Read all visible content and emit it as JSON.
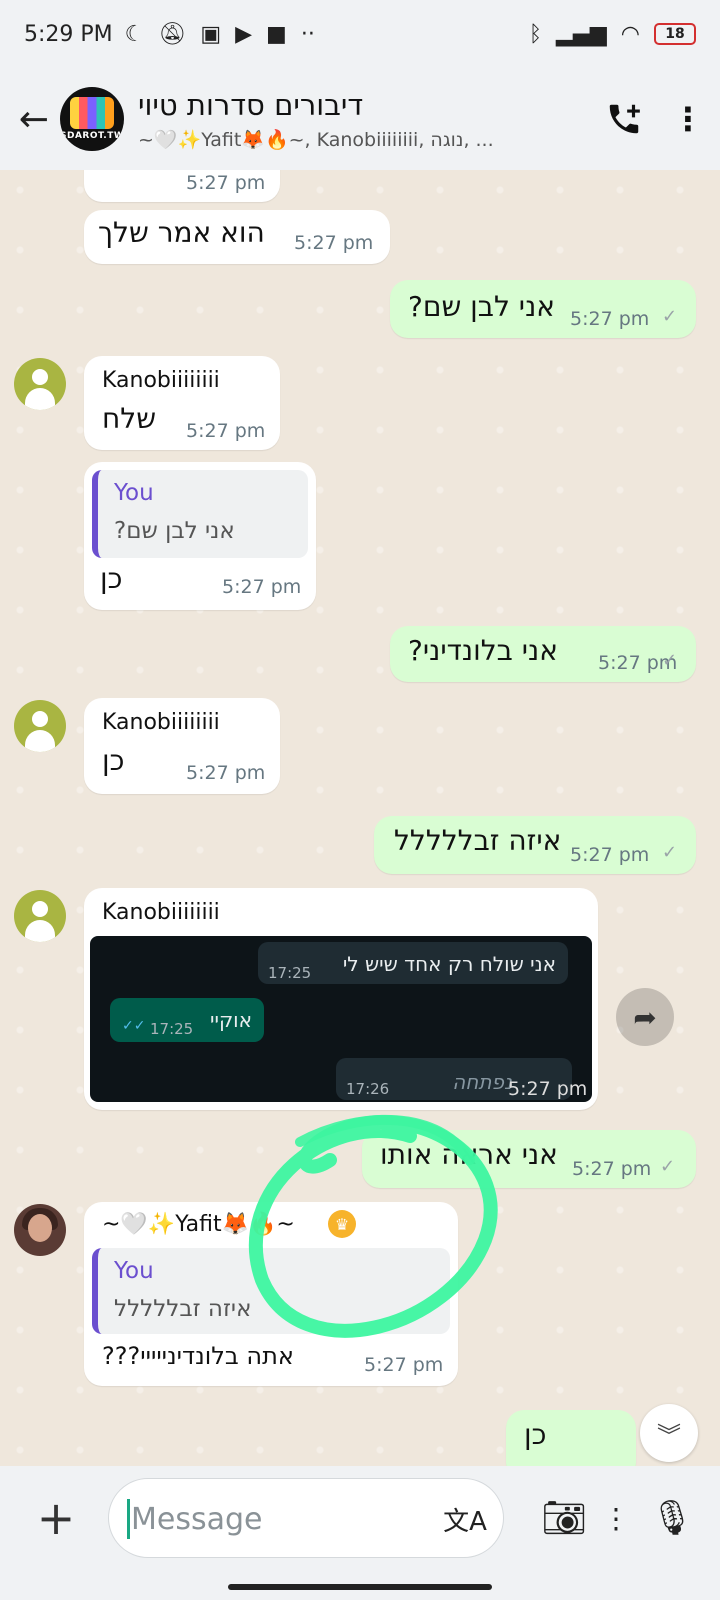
{
  "status": {
    "time": "5:29 PM",
    "battery": "18"
  },
  "header": {
    "title": "דיבורים סדרות טיוי",
    "subtitle": "~🤍✨Yafit🦊🔥~, Kanobiiiiiiii, נוגה, ...",
    "avatar_text": "SDAROT.TW"
  },
  "messages": {
    "top_partial_time": "5:27 pm",
    "m1_text": "הוא אמר שלך",
    "m1_time": "5:27 pm",
    "m2_text": "אני לבן שם?",
    "m2_time": "5:27 pm",
    "m3_sender": "Kanobiiiiiiii",
    "m3_text": "שלח",
    "m3_time": "5:27 pm",
    "m4_quote_name": "You",
    "m4_quote_text": "אני לבן שם?",
    "m4_text": "כן",
    "m4_time": "5:27 pm",
    "m5_text": "אני בלונדיני?",
    "m5_time": "5:27 pm",
    "m6_sender": "Kanobiiiiiiii",
    "m6_text": "כן",
    "m6_time": "5:27 pm",
    "m7_text": "איזה זבללללל",
    "m7_time": "5:27 pm",
    "m8_sender": "Kanobiiiiiiii",
    "m8_shot_in1_text": "אני שולח רק אחד שיש לי",
    "m8_shot_in1_time": "17:25",
    "m8_shot_out_text": "אוקיי",
    "m8_shot_out_time": "17:25",
    "m8_shot_in2_text": "נפתחה",
    "m8_shot_in2_time": "17:26",
    "m8_time": "5:27 pm",
    "m9_text": "אני אראה אותו",
    "m9_time": "5:27 pm",
    "m10_sender": "~🤍✨Yafit🦊🔥~",
    "m10_quote_name": "You",
    "m10_quote_text": "איזה זבללללל",
    "m10_text": "אתה בלונדינייייי???",
    "m10_time": "5:27 pm",
    "m11_text": "כן"
  },
  "input": {
    "placeholder": "Message"
  },
  "colors": {
    "outgoing_bubble": "#d9fdd3",
    "incoming_bubble": "#ffffff",
    "chat_bg": "#efe7dc",
    "annotation": "#3df5a0",
    "quote_accent": "#6b4fcf"
  }
}
